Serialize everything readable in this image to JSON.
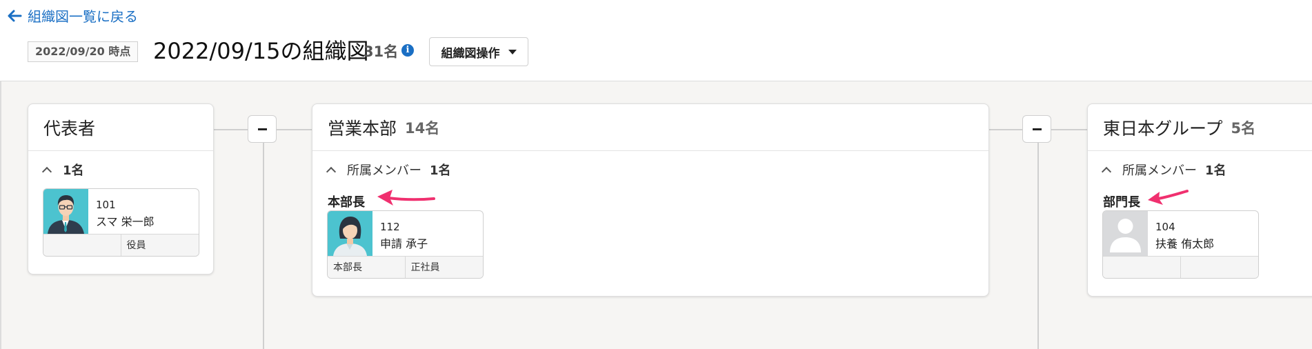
{
  "header": {
    "back_link": "組織図一覧に戻る",
    "date_badge": "2022/09/20 時点",
    "title": "2022/09/15の組織図",
    "count": "31名",
    "info_glyph": "i",
    "ops_button": "組織図操作"
  },
  "colors": {
    "accent": "#1a6fc4",
    "arrow": "#f0306f",
    "avatar_teal": "#4cc3cf",
    "avatar_gray": "#d9dadc"
  },
  "cards": [
    {
      "title": "代表者",
      "count": "",
      "section_label": "",
      "section_count": "1名",
      "role": "",
      "member": {
        "no": "101",
        "name": "スマ 栄一郎",
        "position": "",
        "type": "役員",
        "avatar": "male-avatar"
      }
    },
    {
      "title": "営業本部",
      "count": "14名",
      "section_label": "所属メンバー",
      "section_count": "1名",
      "role": "本部長",
      "member": {
        "no": "112",
        "name": "申請 承子",
        "position": "本部長",
        "type": "正社員",
        "avatar": "female-avatar"
      }
    },
    {
      "title": "東日本グループ",
      "count": "5名",
      "section_label": "所属メンバー",
      "section_count": "1名",
      "role": "部門長",
      "member": {
        "no": "104",
        "name": "扶養 侑太郎",
        "position": "",
        "type": "",
        "avatar": "placeholder-avatar"
      }
    }
  ]
}
